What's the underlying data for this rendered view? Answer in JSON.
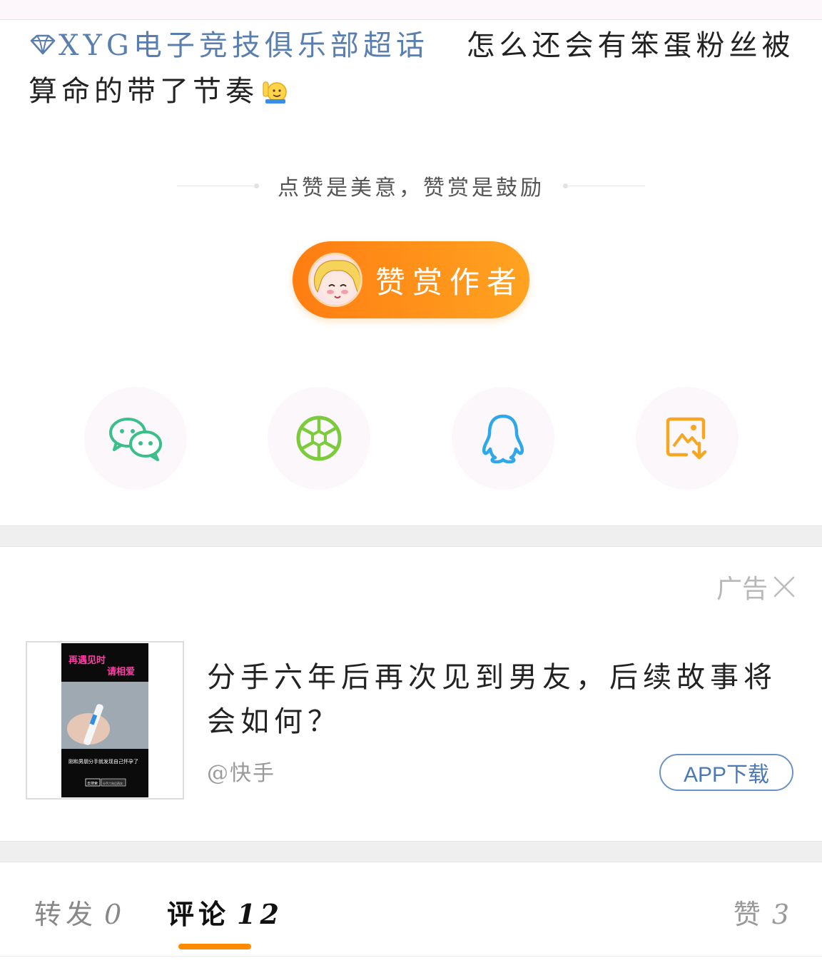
{
  "post": {
    "topic": "XYG电子竞技俱乐部超话",
    "text": "怎么还会有笨蛋粉丝被算命的带了节奏"
  },
  "divider": {
    "text": "点赞是美意，赞赏是鼓励"
  },
  "reward": {
    "label": "赞赏作者"
  },
  "share": {
    "items": [
      "wechat-icon",
      "moments-icon",
      "qq-icon",
      "save-image-icon"
    ]
  },
  "ad": {
    "tag": "广告",
    "title": "分手六年后再次见到男友，后续故事将会如何？",
    "source": "@快手",
    "cta": "APP下载",
    "thumb": {
      "line1": "再遇见时",
      "line2": "请相爱",
      "caption": "刚和男朋分手就发现自己怀孕了",
      "search": "去搜索",
      "search_text": "分手六年后再次"
    }
  },
  "tabs": {
    "repost_label": "转发",
    "repost_count": "0",
    "comment_label": "评论",
    "comment_count": "12",
    "like_label": "赞",
    "like_count": "3"
  },
  "colors": {
    "topic_link": "#5a7fae",
    "reward_start": "#ff7d11",
    "reward_end": "#ffa321",
    "tab_underline": "#ff8a00",
    "wechat": "#3bbf8a",
    "moments": "#7ccb3c",
    "qq": "#2fa7e8",
    "save": "#f5a623"
  }
}
